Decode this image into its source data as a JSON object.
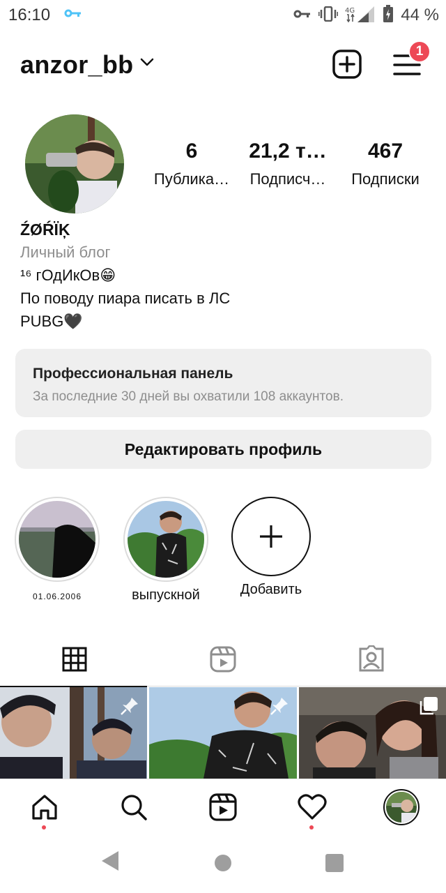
{
  "status_bar": {
    "time": "16:10",
    "network": "4G",
    "battery_percent": "44 %",
    "icons": [
      "key-icon",
      "vpn-key-icon",
      "vibrate-icon",
      "signal-icon",
      "battery-icon"
    ]
  },
  "header": {
    "username": "anzor_bb",
    "notification_count": "1"
  },
  "profile": {
    "stats": [
      {
        "value": "6",
        "label": "Публика…"
      },
      {
        "value": "21,2 т…",
        "label": "Подписч…"
      },
      {
        "value": "467",
        "label": "Подписки"
      }
    ],
    "display_name": "ŹØŔÏĶ",
    "category": "Личный блог",
    "bio_lines": [
      "¹⁶ гОдИкОв😁",
      "По поводу пиара писать в ЛС",
      "PUBG🖤"
    ]
  },
  "pro_panel": {
    "title": "Профессиональная панель",
    "subtitle": "За последние 30 дней вы охватили 108 аккаунтов."
  },
  "edit_profile_label": "Редактировать профиль",
  "highlights": [
    {
      "label": "01.06.2006"
    },
    {
      "label": "выпускной"
    },
    {
      "label": "Добавить"
    }
  ],
  "tabs": [
    "grid-icon",
    "reels-icon",
    "tagged-icon"
  ],
  "bottom_nav": [
    "home-icon",
    "search-icon",
    "reels-icon",
    "heart-icon",
    "profile-avatar"
  ],
  "colors": {
    "accent_red": "#ed4956",
    "panel_bg": "#efefef",
    "muted_text": "#8e8e8e"
  }
}
